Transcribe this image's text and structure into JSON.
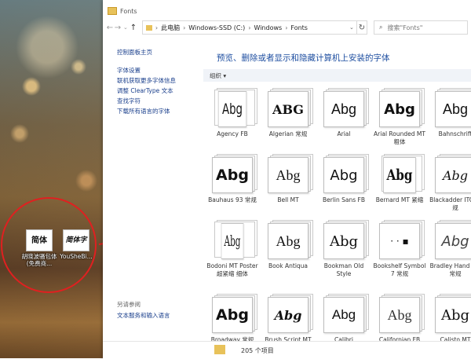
{
  "desktop": {
    "icons": [
      {
        "glyph": "简体",
        "label": "胡晓波骚包体(免费商..."
      },
      {
        "glyph": "简体字",
        "label": "YouSheBi..."
      }
    ]
  },
  "window": {
    "title": "Fonts",
    "address": {
      "crumbs": [
        "此电脑",
        "Windows-SSD (C:)",
        "Windows",
        "Fonts"
      ]
    },
    "search_placeholder": "搜索\"Fonts\""
  },
  "sidebar": {
    "items": [
      "控制面板主页",
      "字体设置",
      "联机获取更多字体信息",
      "调整 ClearType 文本",
      "查找字符",
      "下载所有语言的字体"
    ],
    "see_also": "另请参阅",
    "see_also_link": "文本服务和输入语言"
  },
  "main": {
    "heading": "预览、删除或者显示和隐藏计算机上安装的字体",
    "organize": "组织 ▾"
  },
  "fonts": [
    {
      "name": "Agency FB",
      "sample": "Abg"
    },
    {
      "name": "Algerian 常规",
      "sample": "ABG"
    },
    {
      "name": "Arial",
      "sample": "Abg"
    },
    {
      "name": "Arial Rounded MT 粗体",
      "sample": "Abg"
    },
    {
      "name": "Bahnschrift",
      "sample": "Abg"
    },
    {
      "name": "Bauhaus 93 常规",
      "sample": "Abg"
    },
    {
      "name": "Bell MT",
      "sample": "Abg"
    },
    {
      "name": "Berlin Sans FB",
      "sample": "Abg"
    },
    {
      "name": "Bernard MT 紧缩",
      "sample": "Abg"
    },
    {
      "name": "Blackadder ITC 常规",
      "sample": "Abg"
    },
    {
      "name": "Bodoni MT Poster 超紧缩 细体",
      "sample": "Abg"
    },
    {
      "name": "Book Antiqua",
      "sample": "Abg"
    },
    {
      "name": "Bookman Old Style",
      "sample": "Abg"
    },
    {
      "name": "Bookshelf Symbol 7 常规",
      "sample": "· · ▪"
    },
    {
      "name": "Bradley Hand ITC 常规",
      "sample": "Abg"
    },
    {
      "name": "Broadway 常规",
      "sample": "Abg"
    },
    {
      "name": "Brush Script MT",
      "sample": "Abg"
    },
    {
      "name": "Calibri",
      "sample": "Abg"
    },
    {
      "name": "Californian FB",
      "sample": "Abg"
    },
    {
      "name": "Calisto MT",
      "sample": "Abg"
    }
  ],
  "status": {
    "count": "205 个项目"
  }
}
